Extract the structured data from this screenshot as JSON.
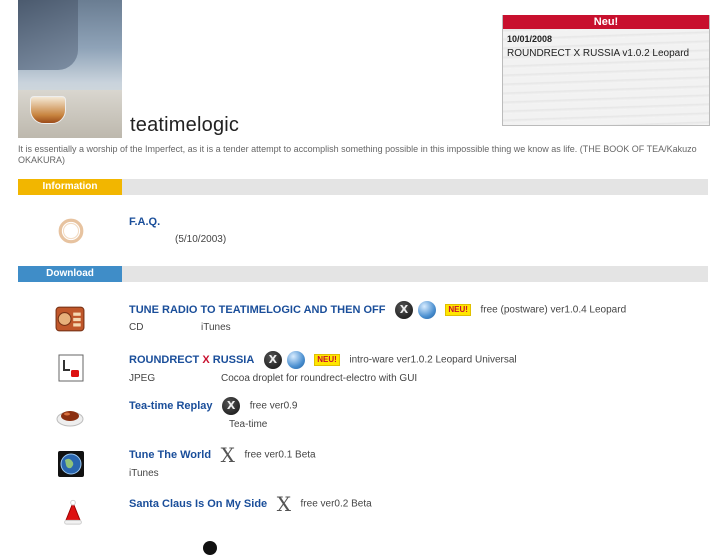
{
  "site": {
    "title": "teatimelogic",
    "tagline": "It is essentially a worship of the Imperfect, as it is a tender attempt to accomplish something possible in this impossible thing we know as life. (THE BOOK OF TEA/Kakuzo OKAKURA)"
  },
  "news": {
    "header": "Neu!",
    "date": "10/01/2008",
    "text": "ROUNDRECT X RUSSIA v1.0.2 Leopard"
  },
  "sections": {
    "information": "Information",
    "download": "Download"
  },
  "faq": {
    "name": "F.A.Q.",
    "date": "(5/10/2003)"
  },
  "downloads": [
    {
      "name": "TUNE RADIO TO TEATIMELOGIC AND THEN OFF",
      "badge": "NEU!",
      "info": "free (postware)  ver1.0.4 Leopard",
      "line2a": "CD",
      "line2b": "iTunes"
    },
    {
      "name_a": "ROUNDRECT",
      "name_x": "X",
      "name_b": "RUSSIA",
      "badge": "NEU!",
      "info": "intro-ware ver1.0.2 Leopard    Universal",
      "line2a": "JPEG",
      "line2b": "Cocoa droplet for roundrect-electro with GUI"
    },
    {
      "name": "Tea-time Replay",
      "info": "free  ver0.9",
      "line2b": "Tea-time"
    },
    {
      "name": "Tune The World",
      "info": "free  ver0.1 Beta",
      "line2a": "iTunes"
    },
    {
      "name": "Santa Claus Is On My Side",
      "info": "free  ver0.2 Beta"
    }
  ],
  "icons": {
    "osx": "mac-os-x-icon",
    "os9": "mac-os-9-icon",
    "osx_glyph": "X"
  },
  "colors": {
    "link": "#1a4e9a",
    "info_bar": "#f2b600",
    "download_bar": "#3f8dc8",
    "news_header": "#c8102e"
  }
}
